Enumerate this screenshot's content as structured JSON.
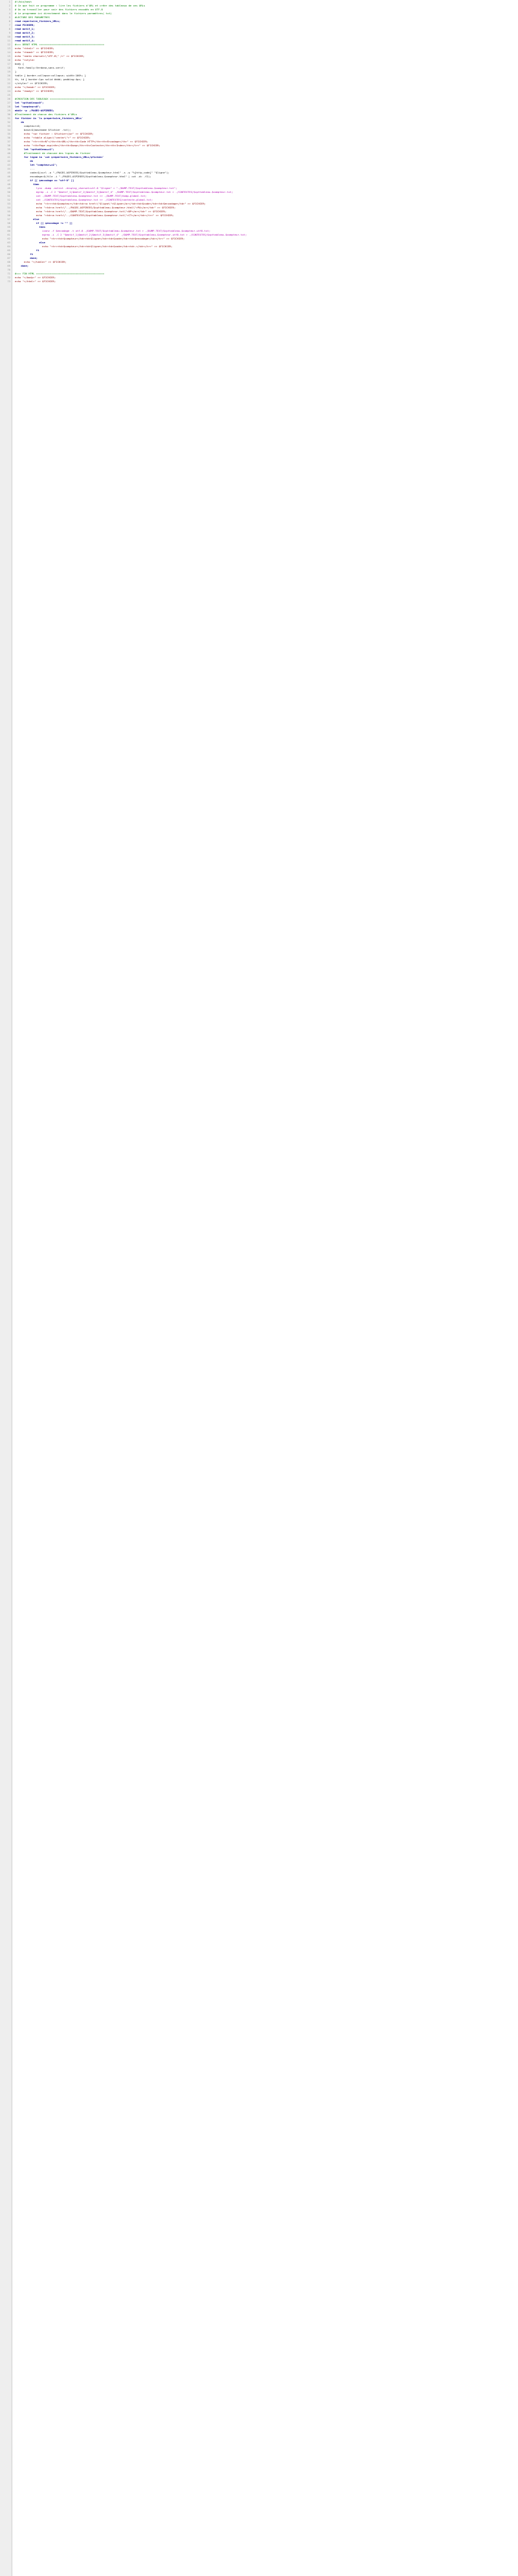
{
  "editor": {
    "lines": [
      "#!/bin/bash",
      "# Ce que fait ce programme : lire les fichiers d'URL et créer des tableaux de ces URLs",
      "# On va travailler pour voir des fichiers encodés en UTF-8",
      "# Le programme ici directement dans le fichiers paramètres( txt)",
      "#LECTURE DES PARAMETRES",
      "read repertoire_fichiers_URLs;",
      "read FICHIER;",
      "read motif_1;",
      "read motif_2;",
      "read motif_3;",
      "read motif_4;",
      "#=== DEBUT HTML ===========================================",
      "echo \"<html>\" >> $FICHIER;",
      "echo \"<head>\" >> $FICHIER;",
      "echo \"<meta charset=\\\"UTF-8\\\" />\" >> $FICHIER;",
      "echo \"<style>",
      "body {",
      "  font-family:Verdana,sans-serif;",
      "}",
      "table { border-collapse:collapse; width:100%; }",
      "th, td { border:1px solid #ddd; padding:4px; }",
      "</style>\" >> $FICHIER;",
      "echo \"</head>\" >> $FICHIER;",
      "echo \"<body>\" >> $FICHIER;",
      "",
      "#CREATION DES TABLEAUX ====================================",
      "let \"cpttableau=0\";",
      "let \"compteur=0\";",
      "mkdir -p ./PAGES-ASPIREES;",
      "#Traitement de chacun des fichiers d'URLs",
      "for fichier in `ls $repertoire_fichiers_URLs`",
      "    do",
      "      compteur=0;",
      "      base=$(basename $fichier .txt);",
      "      echo \"<p> fichier : $fichier</p>\" >> $FICHIER;",
      "      echo \"<table align=\\\"center\\\">\" >> $FICHIER;",
      "      echo \"<tr><th>N°</th><th>URL</th><th>Code HTTP</th><th>Encodage</th>\" >> $FICHIER;",
      "      echo \"<th>Page aspirée</th><th>Dump</th><th>Contexte</th><th>Index</th></tr>\" >> $FICHIER;",
      "      let \"cpttableau+=1\";",
      "      #Traitement de chacune des lignes du fichier",
      "      for ligne in `cat $repertoire_fichiers_URLs/$fichier`",
      "          do",
      "          let \"compteur+=1\";",
      "          ...",
      "          code=$(curl -o \"./PAGES-ASPIREES/$cpttableau-$compteur.html\" -s -w \"%{http_code}\" \"$ligne\");",
      "          encodage=$(file -i \"./PAGES-ASPIREES/$cpttableau-$compteur.html\" | cut -d= -f2);",
      "          if [[ $encodage == \"utf-8\" ]]",
      "            then",
      "              lynx -dump -nolist -display_charset=utf-8 \"$ligne\" > \"./DUMP-TEXT/$cpttableau-$compteur.txt\";",
      "              egrep -i -C 2 \"$motif_1|$motif_2|$motif_3|$motif_4\" ./DUMP-TEXT/$cpttableau-$compteur.txt > ./CONTEXTES/$cpttableau-$compteur.txt;",
      "              cat ./DUMP-TEXT/$cpttableau-$compteur.txt >> ./DUMP-TEXT/dump-global.txt;",
      "              cat ./CONTEXTES/$cpttableau-$compteur.txt >> ./CONTEXTES/contexte-global.txt;",
      "              echo \"<tr><td>$compteur</td><td><a href=\\\"$ligne\\\">$ligne</a></td><td>$code</td><td>$encodage</td>\" >> $FICHIER;",
      "              echo \"<td><a href=\\\"../PAGES-ASPIREES/$cpttableau-$compteur.html\\\">PA</a></td>\" >> $FICHIER;",
      "              echo \"<td><a href=\\\"../DUMP-TEXT/$cpttableau-$compteur.txt\\\">DP</a></td>\" >> $FICHIER;",
      "              echo \"<td><a href=\\\"../CONTEXTES/$cpttableau-$compteur.txt\\\">CT</a></td></tr>\" >> $FICHIER;",
      "            else",
      "              if [[ $encodage != \"\" ]]",
      "                then",
      "                  iconv -f $encodage -t utf-8 ./DUMP-TEXT/$cpttableau-$compteur.txt > ./DUMP-TEXT/$cpttableau-$compteur-utf8.txt;",
      "                  egrep -i -C 2 \"$motif_1|$motif_2|$motif_3|$motif_4\" ./DUMP-TEXT/$cpttableau-$compteur-utf8.txt > ./CONTEXTES/$cpttableau-$compteur.txt;",
      "                  echo \"<tr><td>$compteur</td><td>$ligne</td><td>$code</td><td>$encodage</td></tr>\" >> $FICHIER;",
      "                else",
      "                  echo \"<tr><td>$compteur</td><td>$ligne</td><td>$code</td><td>-</td></tr>\" >> $FICHIER;",
      "              fi",
      "          fi",
      "          done;",
      "      echo \"</table>\" >> $FICHIER;",
      "    done;",
      "",
      "#=== FIN HTML =============================================",
      "echo \"</body>\" >> $FICHIER;",
      "echo \"</html>\" >> $FICHIER;"
    ]
  }
}
